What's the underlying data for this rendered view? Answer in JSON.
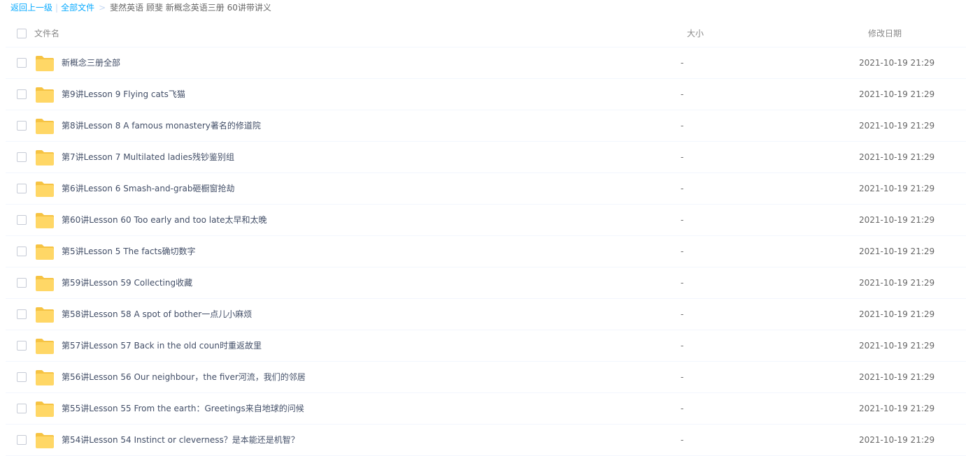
{
  "breadcrumb": {
    "back": "返回上一级",
    "sep1": "|",
    "all_files": "全部文件",
    "sep2": ">",
    "current": "斐然英语 顾斐 新概念英语三册 60讲带讲义"
  },
  "columns": {
    "name": "文件名",
    "size": "大小",
    "modified": "修改日期"
  },
  "colors": {
    "link": "#09aaff",
    "folder": "#ffd766",
    "folder_tab": "#f6c343"
  },
  "files": [
    {
      "name": "新概念三册全部",
      "size": "-",
      "date": "2021-10-19 21:29",
      "icon": "folder-icon"
    },
    {
      "name": "第9讲Lesson 9 Flying cats飞猫",
      "size": "-",
      "date": "2021-10-19 21:29",
      "icon": "folder-icon"
    },
    {
      "name": "第8讲Lesson 8 A famous monastery著名的修道院",
      "size": "-",
      "date": "2021-10-19 21:29",
      "icon": "folder-icon"
    },
    {
      "name": "第7讲Lesson 7 Multilated ladies残钞鉴别组",
      "size": "-",
      "date": "2021-10-19 21:29",
      "icon": "folder-icon"
    },
    {
      "name": "第6讲Lesson 6 Smash-and-grab砸橱窗抢劫",
      "size": "-",
      "date": "2021-10-19 21:29",
      "icon": "folder-icon"
    },
    {
      "name": "第60讲Lesson 60 Too early and too late太早和太晚",
      "size": "-",
      "date": "2021-10-19 21:29",
      "icon": "folder-icon"
    },
    {
      "name": "第5讲Lesson 5 The facts确切数字",
      "size": "-",
      "date": "2021-10-19 21:29",
      "icon": "folder-icon"
    },
    {
      "name": "第59讲Lesson 59 Collecting收藏",
      "size": "-",
      "date": "2021-10-19 21:29",
      "icon": "folder-icon"
    },
    {
      "name": "第58讲Lesson 58 A spot of bother一点儿小麻烦",
      "size": "-",
      "date": "2021-10-19 21:29",
      "icon": "folder-icon"
    },
    {
      "name": "第57讲Lesson 57 Back in the old coun时重返故里",
      "size": "-",
      "date": "2021-10-19 21:29",
      "icon": "folder-icon"
    },
    {
      "name": "第56讲Lesson 56 Our neighbour，the fiver河流，我们的邻居",
      "size": "-",
      "date": "2021-10-19 21:29",
      "icon": "folder-icon"
    },
    {
      "name": "第55讲Lesson 55 From the earth：Greetings来自地球的问候",
      "size": "-",
      "date": "2021-10-19 21:29",
      "icon": "folder-icon"
    },
    {
      "name": "第54讲Lesson 54 Instinct or cleverness？是本能还是机智？",
      "size": "-",
      "date": "2021-10-19 21:29",
      "icon": "folder-icon"
    }
  ]
}
